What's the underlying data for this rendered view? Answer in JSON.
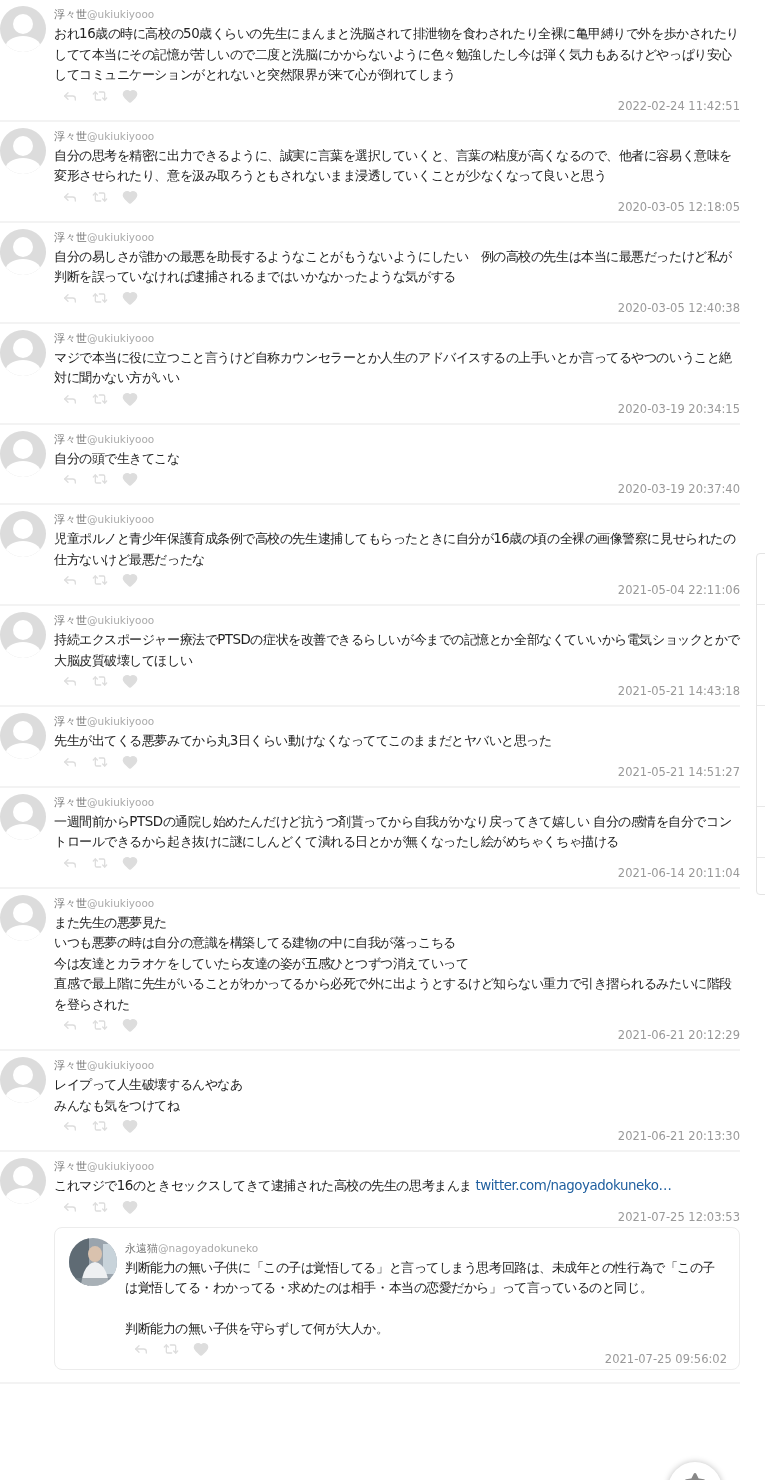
{
  "posts": [
    {
      "name": "浮々世",
      "handle": "@ukiukiyooo",
      "lines": [
        "おれ16歳の時に高校の50歳くらいの先生にまんまと洗脳されて排泄物を食わされたり全裸に亀甲縛りで外を歩かされたりしてて本当にその記憶が苦しいので二度と洗脳にかからないように色々勉強したし今は弾く気力もあるけどやっぱり安心してコミュニケーションがとれないと突然限界が来て心が倒れてしまう"
      ],
      "time": "2022-02-24 11:42:51"
    },
    {
      "name": "浮々世",
      "handle": "@ukiukiyooo",
      "lines": [
        "自分の思考を精密に出力できるように、誠実に言葉を選択していくと、言葉の粘度が高くなるので、他者に容易く意味を変形させられたり、意を汲み取ろうともされないまま浸透していくことが少なくなって良いと思う"
      ],
      "time": "2020-03-05 12:18:05"
    },
    {
      "name": "浮々世",
      "handle": "@ukiukiyooo",
      "lines": [
        "自分の易しさが誰かの最悪を助長するようなことがもうないようにしたい　例の高校の先生は本当に最悪だったけど私が判断を誤っていなければ逮捕されるまではいかなかったような気がする"
      ],
      "time": "2020-03-05 12:40:38"
    },
    {
      "name": "浮々世",
      "handle": "@ukiukiyooo",
      "lines": [
        "マジで本当に役に立つこと言うけど自称カウンセラーとか人生のアドバイスするの上手いとか言ってるやつのいうこと絶対に聞かない方がいい"
      ],
      "time": "2020-03-19 20:34:15"
    },
    {
      "name": "浮々世",
      "handle": "@ukiukiyooo",
      "lines": [
        "自分の頭で生きてこな"
      ],
      "time": "2020-03-19 20:37:40"
    },
    {
      "name": "浮々世",
      "handle": "@ukiukiyooo",
      "lines": [
        "児童ポルノと青少年保護育成条例で高校の先生逮捕してもらったときに自分が16歳の頃の全裸の画像警察に見せられたの仕方ないけど最悪だったな"
      ],
      "time": "2021-05-04 22:11:06"
    },
    {
      "name": "浮々世",
      "handle": "@ukiukiyooo",
      "lines": [
        "持続エクスポージャー療法でPTSDの症状を改善できるらしいが今までの記憶とか全部なくていいから電気ショックとかで大脳皮質破壊してほしい"
      ],
      "time": "2021-05-21 14:43:18"
    },
    {
      "name": "浮々世",
      "handle": "@ukiukiyooo",
      "lines": [
        "先生が出てくる悪夢みてから丸3日くらい動けなくなっててこのままだとヤバいと思った"
      ],
      "time": "2021-05-21 14:51:27"
    },
    {
      "name": "浮々世",
      "handle": "@ukiukiyooo",
      "lines": [
        "一週間前からPTSDの通院し始めたんだけど抗うつ剤貰ってから自我がかなり戻ってきて嬉しい 自分の感情を自分でコントロールできるから起き抜けに謎にしんどくて潰れる日とかが無くなったし絵がめちゃくちゃ描ける"
      ],
      "time": "2021-06-14 20:11:04"
    },
    {
      "name": "浮々世",
      "handle": "@ukiukiyooo",
      "lines": [
        "また先生の悪夢見た",
        "いつも悪夢の時は自分の意識を構築してる建物の中に自我が落っこちる",
        "今は友達とカラオケをしていたら友達の姿が五感ひとつずつ消えていって",
        "直感で最上階に先生がいることがわかってるから必死で外に出ようとするけど知らない重力で引き摺られるみたいに階段を登らされた"
      ],
      "time": "2021-06-21 20:12:29"
    },
    {
      "name": "浮々世",
      "handle": "@ukiukiyooo",
      "lines": [
        "レイプって人生破壊するんやなあ",
        "みんなも気をつけてね"
      ],
      "time": "2021-06-21 20:13:30"
    },
    {
      "name": "浮々世",
      "handle": "@ukiukiyooo",
      "lines": [
        "これマジで16のときセックスしてきて逮捕された高校の先生の思考まんま "
      ],
      "link": "twitter.com/nagoyadokuneko…",
      "time": "2021-07-25 12:03:53",
      "quote": {
        "name": "永遠猫",
        "handle": "@nagoyadokuneko",
        "lines": [
          "判断能力の無い子供に「この子は覚悟してる」と言ってしまう思考回路は、未成年との性行為で「この子は覚悟してる・わかってる・求めたのは相手・本当の恋愛だから」って言っているのと同じ。",
          "判断能力の無い子供を守らずして何が大人か。"
        ],
        "time": "2021-07-25 09:56:02"
      }
    }
  ]
}
